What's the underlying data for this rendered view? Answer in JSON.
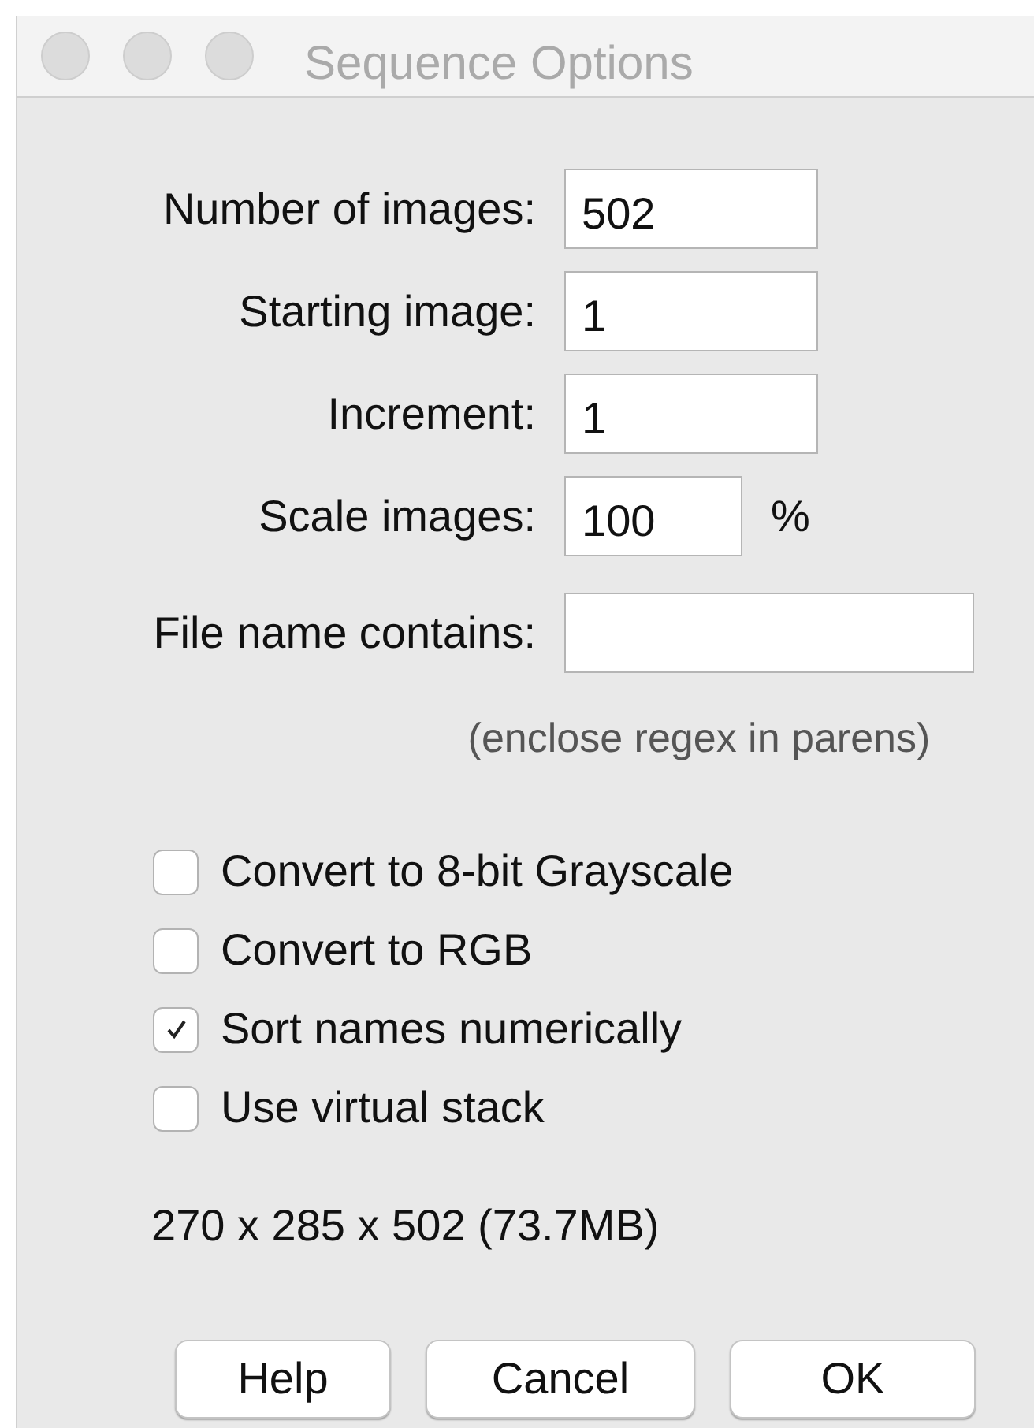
{
  "window": {
    "title": "Sequence Options"
  },
  "fields": [
    {
      "label": "Number of images:",
      "kind": "number",
      "value": "502"
    },
    {
      "label": "Starting image:",
      "kind": "number",
      "value": "1"
    },
    {
      "label": "Increment:",
      "kind": "number",
      "value": "1"
    },
    {
      "label": "Scale images:",
      "kind": "number",
      "value": "100",
      "suffix": "%"
    },
    {
      "label": "File name contains:",
      "kind": "text"
    }
  ],
  "hint": "(enclose regex in parens)",
  "checkboxes": [
    {
      "label": "Convert to 8-bit Grayscale",
      "checked": false
    },
    {
      "label": "Convert to RGB",
      "checked": false
    },
    {
      "label": "Sort names numerically",
      "checked": true
    },
    {
      "label": "Use virtual stack",
      "checked": false
    }
  ],
  "summary": "270 x 285 x 502 (73.7MB)",
  "buttons": [
    "Help",
    "Cancel",
    "OK"
  ]
}
